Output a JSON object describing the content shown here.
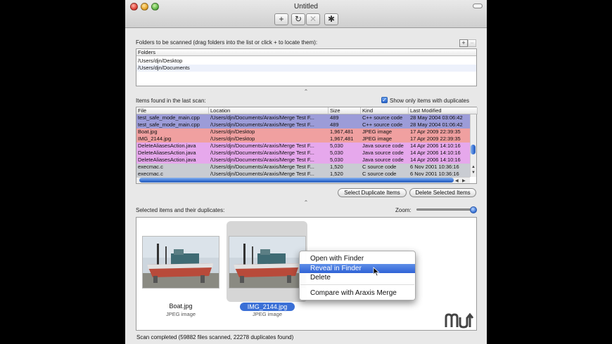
{
  "window": {
    "title": "Untitled",
    "toolbar": {
      "add_icon": "plus-icon",
      "refresh_icon": "refresh-icon",
      "stop_icon": "close-icon",
      "settings_icon": "gear-icon",
      "add_glyph": "+",
      "refresh_glyph": "↻",
      "stop_glyph": "✕",
      "settings_glyph": "✱"
    }
  },
  "folders": {
    "label": "Folders to be scanned (drag folders into the list or click + to locate them):",
    "header": "Folders",
    "add_label": "+",
    "remove_label": "−",
    "items": [
      "/Users/djn/Desktop",
      "/Users/djn/Documents"
    ]
  },
  "items": {
    "label": "Items found in the last scan:",
    "show_duplicates_label": "Show only items with duplicates",
    "show_duplicates_checked": true,
    "columns": [
      "File",
      "Location",
      "Size",
      "Kind",
      "Last Modified"
    ],
    "rows": [
      {
        "file": "test_safe_mode_main.cpp",
        "location": "/Users/djn/Documents/Araxis/Merge Test F...",
        "size": "489",
        "kind": "C++ source code",
        "modified": "28 May 2004 03:06:42",
        "color": "#9c9cd8"
      },
      {
        "file": "test_safe_mode_main.cpp",
        "location": "/Users/djn/Documents/Araxis/Merge Test F...",
        "size": "489",
        "kind": "C++ source code",
        "modified": "28 May 2004 01:06:42",
        "color": "#9c9cd8"
      },
      {
        "file": "Boat.jpg",
        "location": "/Users/djn/Desktop",
        "size": "1,967,481",
        "kind": "JPEG image",
        "modified": "17 Apr 2009 22:39:35",
        "color": "#f0a0a0"
      },
      {
        "file": "IMG_2144.jpg",
        "location": "/Users/djn/Desktop",
        "size": "1,967,481",
        "kind": "JPEG image",
        "modified": "17 Apr 2009 22:39:35",
        "color": "#f0a0a0"
      },
      {
        "file": "DeleteAliasesAction.java",
        "location": "/Users/djn/Documents/Araxis/Merge Test F...",
        "size": "5,030",
        "kind": "Java source code",
        "modified": "14 Apr 2006 14:10:16",
        "color": "#e6a8ec"
      },
      {
        "file": "DeleteAliasesAction.java",
        "location": "/Users/djn/Documents/Araxis/Merge Test F...",
        "size": "5,030",
        "kind": "Java source code",
        "modified": "14 Apr 2006 14:10:16",
        "color": "#e6a8ec"
      },
      {
        "file": "DeleteAliasesAction.java",
        "location": "/Users/djn/Documents/Araxis/Merge Test F...",
        "size": "5,030",
        "kind": "Java source code",
        "modified": "14 Apr 2006 14:10:16",
        "color": "#e6a8ec"
      },
      {
        "file": "execmac.c",
        "location": "/Users/djn/Documents/Araxis/Merge Test F...",
        "size": "1,520",
        "kind": "C source code",
        "modified": "6 Nov 2001 10:36:16",
        "color": "#c9ccd2"
      },
      {
        "file": "execmac.c",
        "location": "/Users/djn/Documents/Araxis/Merge Test F...",
        "size": "1,520",
        "kind": "C source code",
        "modified": "6 Nov 2001 10:36:16",
        "color": "#c9ccd2"
      }
    ],
    "select_duplicates_label": "Select Duplicate Items",
    "delete_selected_label": "Delete Selected Items"
  },
  "preview": {
    "label": "Selected items and their duplicates:",
    "zoom_label": "Zoom:",
    "zoom_level": 1.0,
    "thumbnails": [
      {
        "name": "Boat.jpg",
        "kind": "JPEG image",
        "selected": false
      },
      {
        "name": "IMG_2144.jpg",
        "kind": "JPEG image",
        "selected": true
      }
    ]
  },
  "context_menu": {
    "items": [
      "Open with Finder",
      "Reveal in Finder",
      "Delete",
      "Compare with Araxis Merge"
    ],
    "highlighted_index": 1
  },
  "status": {
    "text": "Scan completed (59882 files scanned, 22278 duplicates found)"
  },
  "grip_glyph": "⌃",
  "colors": {
    "accent": "#3a74d6",
    "selection": "#2f62d6"
  }
}
